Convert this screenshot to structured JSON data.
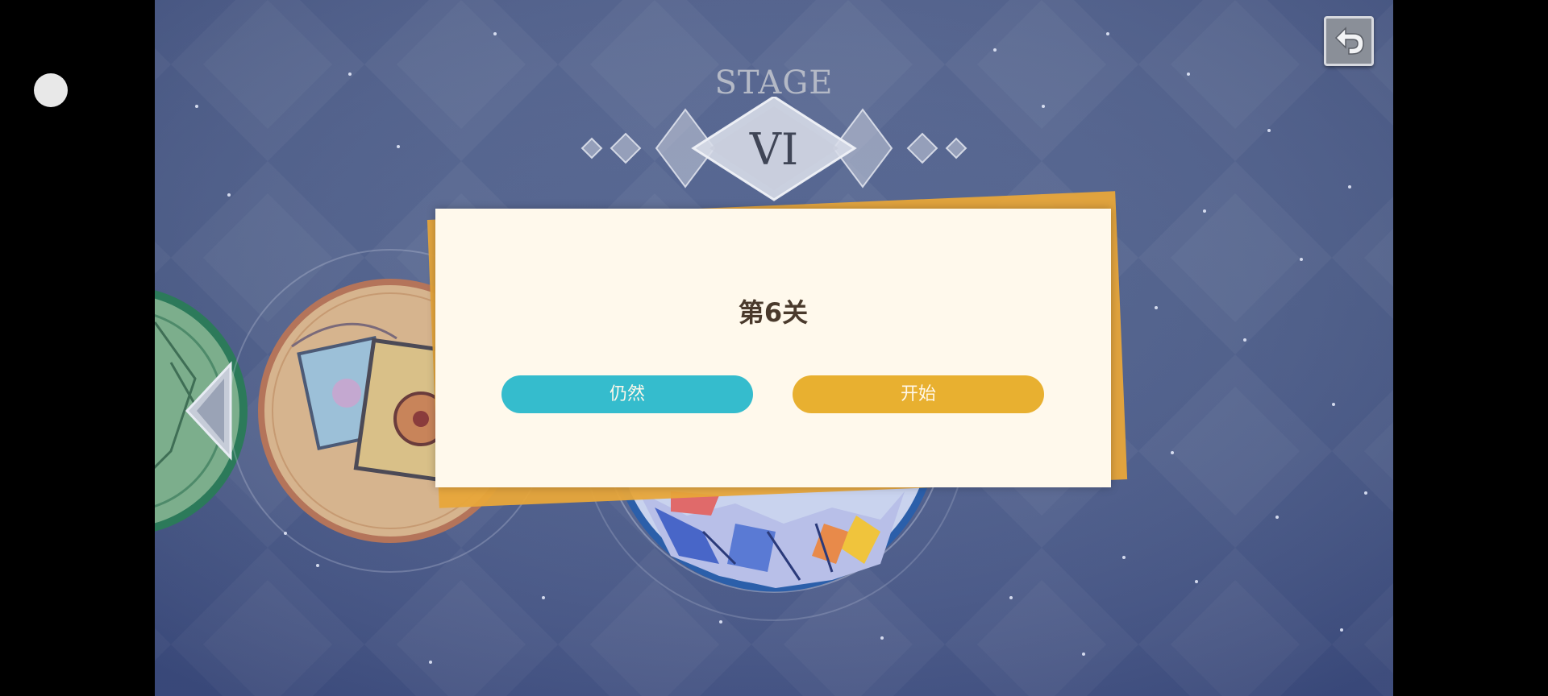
{
  "stage": {
    "label": "STAGE",
    "numeral": "VI"
  },
  "dialog": {
    "title": "第6关",
    "cancel_label": "仍然",
    "start_label": "开始"
  },
  "icons": {
    "back": "back-arrow-icon",
    "prev": "left-arrow-icon"
  },
  "colors": {
    "background": "#4a5b89",
    "dialog_bg": "#fff9ec",
    "dialog_accent": "#e8a63a",
    "cancel_button": "#35bccd",
    "start_button": "#e8b030",
    "title_text": "#4a3a2c"
  }
}
